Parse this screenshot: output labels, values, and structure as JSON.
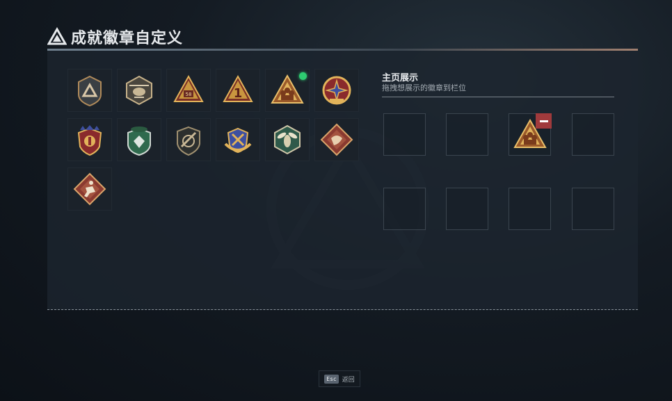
{
  "header": {
    "title": "成就徽章自定义",
    "caption": ""
  },
  "badges": [
    {
      "icon": "shield-triangle-badge",
      "selected": false
    },
    {
      "icon": "helicopter-badge",
      "selected": false
    },
    {
      "icon": "triangle-58-badge",
      "selected": false
    },
    {
      "icon": "triangle-1-badge",
      "selected": false
    },
    {
      "icon": "squad-triangle-badge",
      "selected": true
    },
    {
      "icon": "red-cross-medal-badge",
      "selected": false
    },
    {
      "icon": "ornate-star-shield-badge",
      "selected": false
    },
    {
      "icon": "green-beret-shield-badge",
      "selected": false
    },
    {
      "icon": "knife-shield-badge",
      "selected": false
    },
    {
      "icon": "wings-crest-badge",
      "selected": false
    },
    {
      "icon": "wasp-hexagon-badge",
      "selected": false
    },
    {
      "icon": "dragon-diamond-badge",
      "selected": false
    },
    {
      "icon": "runner-diamond-badge",
      "selected": false
    }
  ],
  "showcase": {
    "title": "主页展示",
    "subtitle": "拖拽想展示的徽章到栏位",
    "slots": [
      "",
      "",
      "squad-triangle-badge",
      "",
      "",
      "",
      "",
      ""
    ],
    "remove_icon": "minus-icon"
  },
  "footer": {
    "key": "Esc",
    "label": "返回"
  }
}
